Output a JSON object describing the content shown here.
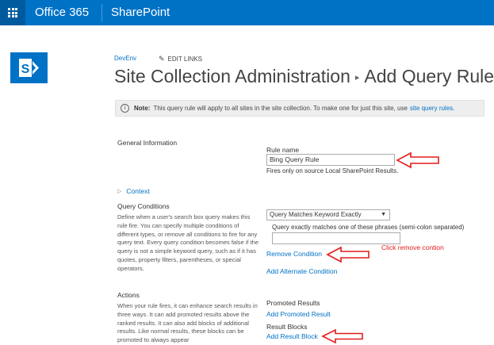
{
  "suite_bar": {
    "office_label": "Office 365",
    "app_label": "SharePoint"
  },
  "header": {
    "site_name": "DevEnv",
    "edit_links": "EDIT LINKS",
    "title_part1": "Site Collection Administration",
    "title_sep": "▸",
    "title_part2": "Add Query Rule"
  },
  "note": {
    "label": "Note:",
    "text": "This query rule will apply to all sites in the site collection. To make one for just this site, use",
    "link": "site query rules",
    "tail": "."
  },
  "general_info": {
    "title": "General Information",
    "rule_name_label": "Rule name",
    "rule_name_value": "Bing Query Rule",
    "fires_only": "Fires only on source Local SharePoint Results."
  },
  "context": {
    "label": "Context"
  },
  "query_conditions": {
    "title": "Query Conditions",
    "description": "Define when a user's search box query makes this rule fire. You can specify multiple conditions of different types, or remove all conditions to fire for any query text. Every query condition becomes false if the query is not a simple keyword query, such as if it has quotes, property filters, parentheses, or special operators.",
    "selected_condition": "Query Matches Keyword Exactly",
    "phrases_label": "Query exactly matches one of these phrases (semi-colon separated)",
    "phrases_value": "",
    "remove_condition": "Remove Condition",
    "add_alternate": "Add Alternate Condition"
  },
  "actions": {
    "title": "Actions",
    "description": "When your rule fires, it can enhance search results in three ways. It can add promoted results above the ranked results. It can also add blocks of additional results. Like normal results, these blocks can be promoted to always appear",
    "promoted_title": "Promoted Results",
    "add_promoted": "Add Promoted Result",
    "result_blocks_title": "Result Blocks",
    "add_result_block": "Add Result Block"
  },
  "annotations": {
    "click_remove": "Click remove contion"
  },
  "colors": {
    "suite_bar": "#0072c6",
    "link": "#0072c6",
    "annotation": "#e31c1c"
  }
}
